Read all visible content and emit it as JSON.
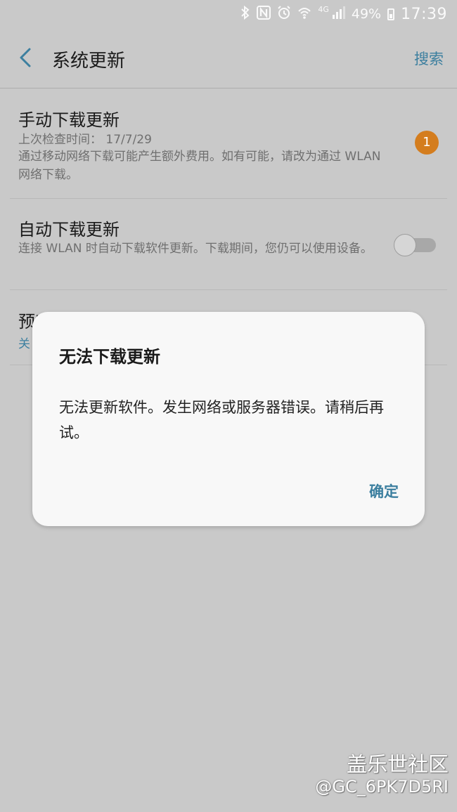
{
  "status_bar": {
    "icons": [
      "bluetooth-icon",
      "nfc-icon",
      "alarm-icon",
      "wifi-icon",
      "signal-icon"
    ],
    "network": "4G",
    "battery": "49%",
    "time": "17:39"
  },
  "app_bar": {
    "back_icon": "chevron-left-icon",
    "title": "系统更新",
    "search_label": "搜索"
  },
  "list": {
    "manual": {
      "title": "手动下载更新",
      "last_checked": "上次检查时间： 17/7/29",
      "description": "通过移动网络下载可能产生额外费用。如有可能，请改为通过 WLAN 网络下载。",
      "badge": "1"
    },
    "auto": {
      "title": "自动下载更新",
      "description": "连接 WLAN 时自动下载软件更新。下载期间，您仍可以使用设备。",
      "toggle_on": false
    },
    "scheduled": {
      "title": "预定软件更新",
      "status": "关"
    }
  },
  "dialog": {
    "title": "无法下载更新",
    "message": "无法更新软件。发生网络或服务器错误。请稍后再试。",
    "ok_label": "确定"
  },
  "watermark": {
    "line1": "盖乐世社区",
    "line2": "@GC_6PK7D5RI"
  },
  "colors": {
    "accent": "#3c7f9f",
    "badge": "#d47d1e",
    "dim_background": "#c9c9c9",
    "dialog_background": "#f8f8f8"
  }
}
